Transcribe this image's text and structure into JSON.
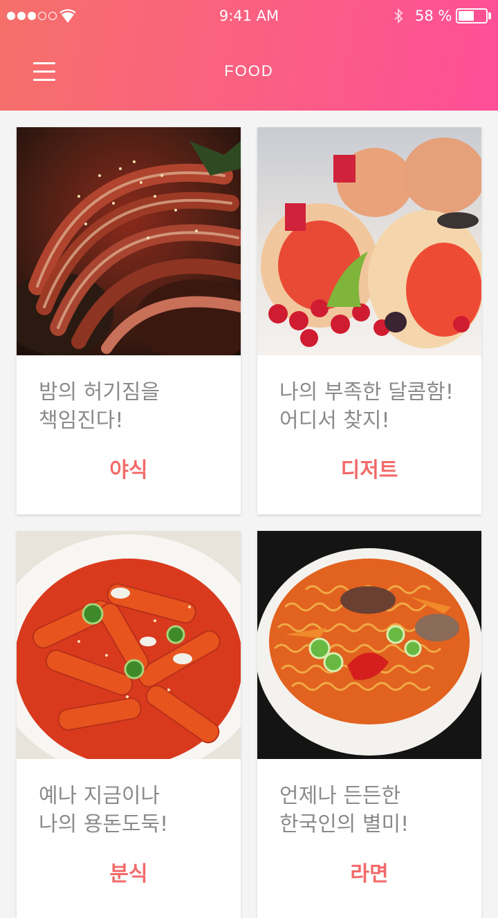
{
  "status_bar": {
    "time": "9:41 AM",
    "battery_percent_label": "58 %",
    "battery_level": 0.58,
    "signal_strength": 3,
    "signal_total": 5
  },
  "header": {
    "title": "FOOD",
    "gradient_colors": [
      "#f6706a",
      "#fe4e98"
    ]
  },
  "accent_color": "#f26a6a",
  "cards": [
    {
      "desc_line1": "밤의 허기짐을",
      "desc_line2": "책임진다!",
      "category": "야식",
      "image": "braised-pork-trotters-photo"
    },
    {
      "desc_line1": "나의 부족한 달콤함!",
      "desc_line2": "어디서 찾지!",
      "category": "디저트",
      "image": "strawberry-roll-cake-photo"
    },
    {
      "desc_line1": "예나 지금이나",
      "desc_line2": "나의 용돈도둑!",
      "category": "분식",
      "image": "tteokbokki-photo"
    },
    {
      "desc_line1": "언제나 든든한",
      "desc_line2": "한국인의 별미!",
      "category": "라면",
      "image": "ramen-bowl-photo"
    }
  ]
}
